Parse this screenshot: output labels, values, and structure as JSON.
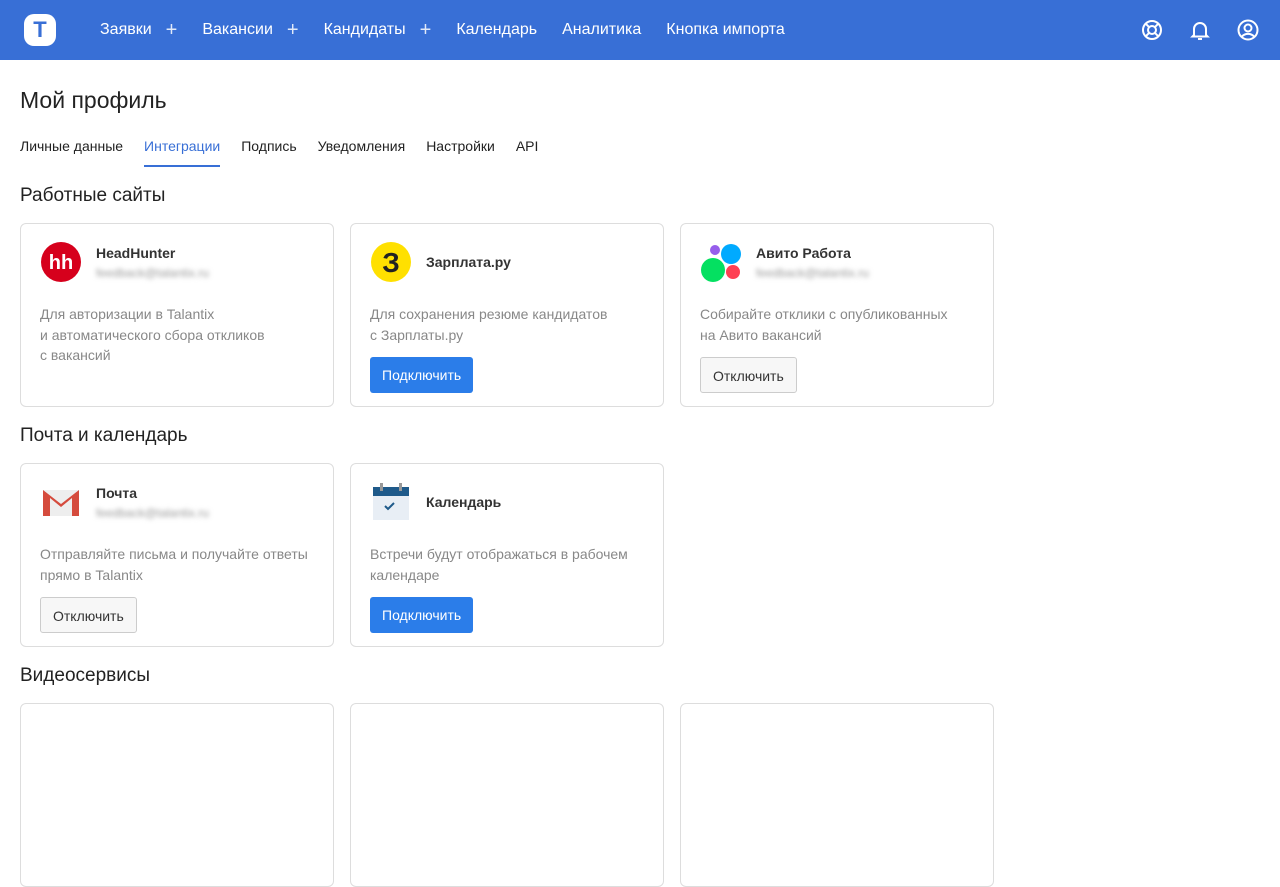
{
  "nav": {
    "items": [
      {
        "label": "Заявки",
        "plus": true
      },
      {
        "label": "Вакансии",
        "plus": true
      },
      {
        "label": "Кандидаты",
        "plus": true
      },
      {
        "label": "Календарь"
      },
      {
        "label": "Аналитика"
      },
      {
        "label": "Кнопка импорта"
      }
    ],
    "logo": "T"
  },
  "page": {
    "title": "Мой профиль"
  },
  "tabs": [
    "Личные данные",
    "Интеграции",
    "Подпись",
    "Уведомления",
    "Настройки",
    "API"
  ],
  "sections": {
    "jobs": "Работные сайты",
    "mail": "Почта и календарь",
    "video": "Видеосервисы"
  },
  "cards": {
    "hh": {
      "name": "HeadHunter",
      "email": "feedback@talantix.ru",
      "desc": "Для авторизации в Talantix\nи автоматического сбора откликов\nс вакансий"
    },
    "zp": {
      "name": "Зарплата.ру",
      "desc": "Для сохранения резюме кандидатов\nс Зарплаты.ру",
      "button": "Подключить"
    },
    "avito": {
      "name": "Авито Работа",
      "email": "feedback@talantix.ru",
      "desc": "Собирайте отклики с опубликованных\nна Авито вакансий",
      "button": "Отключить"
    },
    "mail": {
      "name": "Почта",
      "email": "feedback@talantix.ru",
      "desc": "Отправляйте письма и получайте ответы\nпрямо в Talantix",
      "button": "Отключить"
    },
    "cal": {
      "name": "Календарь",
      "desc": "Встречи будут отображаться в рабочем\nкалендаре",
      "button": "Подключить"
    }
  }
}
